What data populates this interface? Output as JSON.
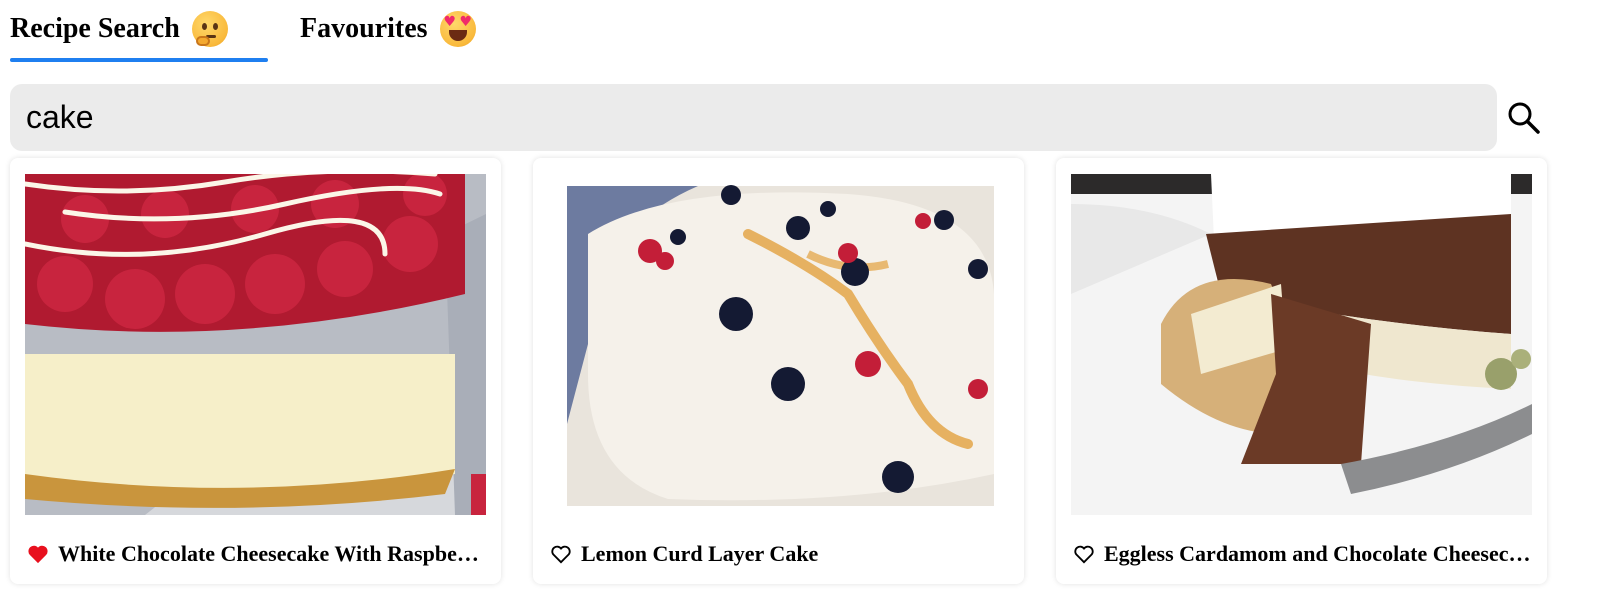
{
  "tabs": [
    {
      "label": "Recipe Search",
      "icon": "thinking-face-icon",
      "active": true
    },
    {
      "label": "Favourites",
      "icon": "heart-eyes-face-icon",
      "active": false
    }
  ],
  "search": {
    "value": "cake",
    "icon": "search-icon"
  },
  "recipes": [
    {
      "title": "White Chocolate Cheesecake With Raspberries",
      "favourite": true,
      "fav_icon": "heart-filled-icon"
    },
    {
      "title": "Lemon Curd Layer Cake",
      "favourite": false,
      "fav_icon": "heart-outline-icon"
    },
    {
      "title": "Eggless Cardamom and Chocolate Cheesecake",
      "favourite": false,
      "fav_icon": "heart-outline-icon"
    }
  ],
  "colors": {
    "accent": "#1f7ff0",
    "favourite": "#e8101e",
    "search_bg": "#ebebeb"
  }
}
